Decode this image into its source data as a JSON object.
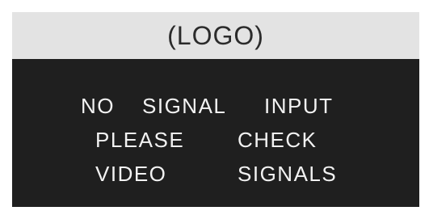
{
  "logo": {
    "text": "(LOGO)"
  },
  "message": {
    "line1": [
      "NO",
      "SIGNAL",
      "INPUT"
    ],
    "line2": [
      "PLEASE",
      "CHECK"
    ],
    "line3": [
      "VIDEO",
      "SIGNALS"
    ]
  },
  "colors": {
    "screen_background": "#1f1f1f",
    "logo_bar": "#e3e3e3",
    "message_text": "#f2f2f2"
  }
}
